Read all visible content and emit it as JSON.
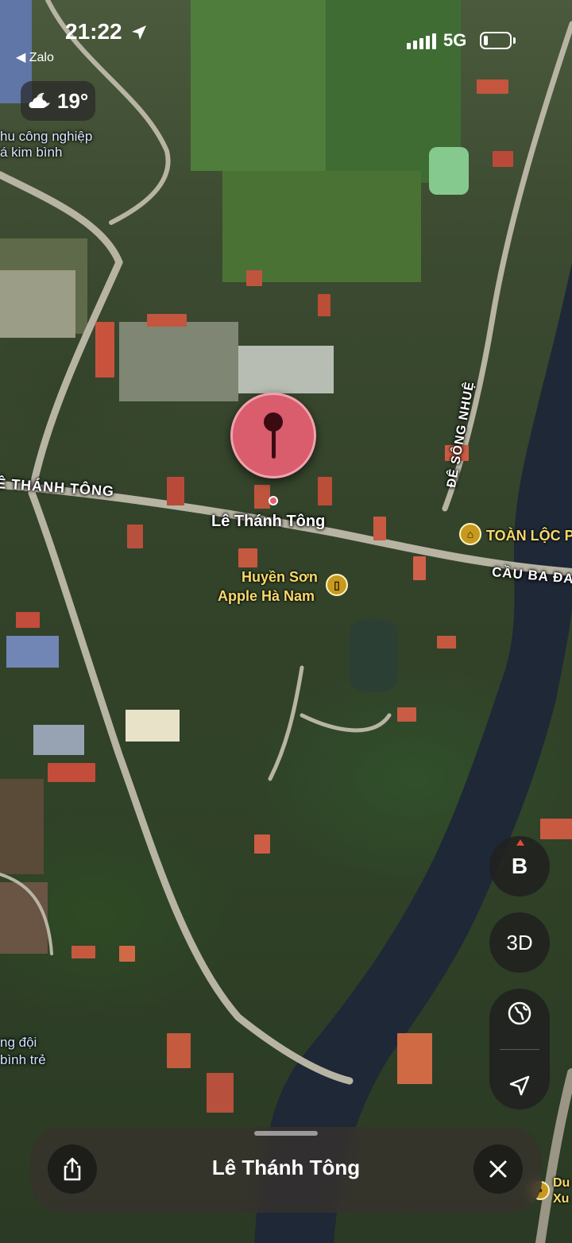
{
  "status_bar": {
    "time": "21:22",
    "back_app": "◀ Zalo",
    "network": "5G",
    "battery_level": 0.15
  },
  "weather": {
    "temperature": "19°",
    "icon": "cloud-moon-icon"
  },
  "map_labels": {
    "industrial_zone_line1": "hu công nghiệp",
    "industrial_zone_line2": "á kim bình",
    "street_left": "Ê THÁNH TÔNG",
    "pin_street": "Lê Thánh Tông",
    "dike": "ĐÊ SÔNG NHUỆ",
    "poi_toan_loc": "TOÀN LỘC P",
    "bridge": "CẦU BA ĐA",
    "poi_huyen_son_line1": "Huyền Sơn",
    "poi_huyen_son_line2": "Apple Hà Nam",
    "area_bottom_line1": "ng đội",
    "area_bottom_line2": "bình trẻ",
    "bottom_right_line1": "Du",
    "bottom_right_line2": "Xu"
  },
  "controls": {
    "compass_heading": "B",
    "view_mode": "3D"
  },
  "place_sheet": {
    "title": "Lê Thánh Tông"
  },
  "colors": {
    "pin": "#d95d6d",
    "poi": "#c79a1f",
    "river": "#1f2a3a"
  }
}
